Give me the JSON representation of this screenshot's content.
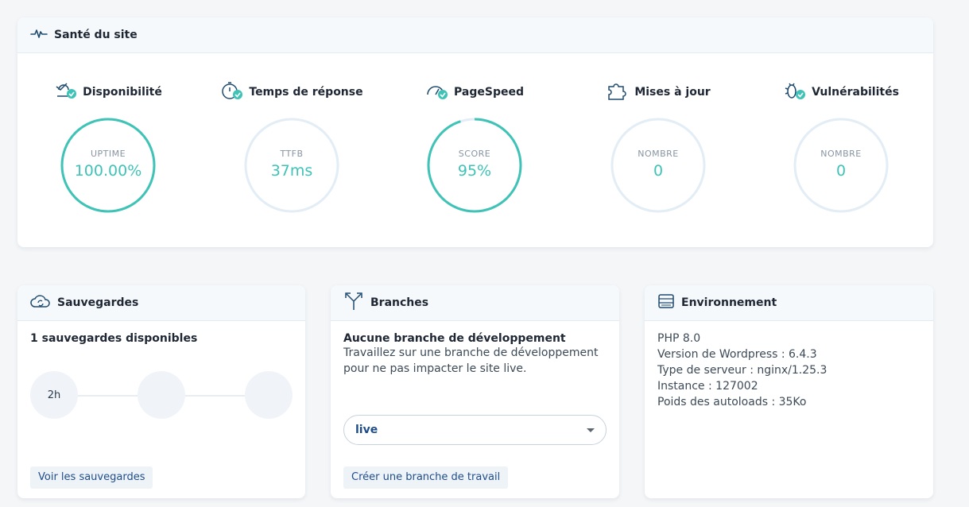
{
  "health": {
    "title": "Santé du site",
    "metrics": [
      {
        "label": "Disponibilité",
        "caption": "UPTIME",
        "value": "100.00%",
        "progress": 1.0,
        "icon": "uptime-check-icon"
      },
      {
        "label": "Temps de réponse",
        "caption": "TTFB",
        "value": "37ms",
        "progress": 0,
        "icon": "stopwatch-check-icon"
      },
      {
        "label": "PageSpeed",
        "caption": "SCORE",
        "value": "95%",
        "progress": 0.95,
        "icon": "gauge-check-icon"
      },
      {
        "label": "Mises à jour",
        "caption": "NOMBRE",
        "value": "0",
        "progress": 0,
        "icon": "puzzle-icon"
      },
      {
        "label": "Vulnérabilités",
        "caption": "NOMBRE",
        "value": "0",
        "progress": 0,
        "icon": "bug-check-icon"
      }
    ]
  },
  "backups": {
    "title": "Sauvegardes",
    "summary": "1 sauvegardes disponibles",
    "timeline": [
      "2h",
      "",
      ""
    ],
    "link": "Voir les sauvegardes"
  },
  "branches": {
    "title": "Branches",
    "heading": "Aucune branche de développement",
    "description": "Travaillez sur une branche de développement pour ne pas impacter le site live.",
    "select_value": "live",
    "create_button": "Créer une branche de travail"
  },
  "environment": {
    "title": "Environnement",
    "lines": [
      "PHP 8.0",
      "Version de Wordpress : 6.4.3",
      "Type de serveur : nginx/1.25.3",
      "Instance : 127002",
      "Poids des autoloads : 35Ko"
    ]
  },
  "colors": {
    "accent": "#3fc3b6",
    "ring_track": "#e3edf6",
    "link": "#1f4d8a",
    "icon": "#1e4a6e"
  }
}
